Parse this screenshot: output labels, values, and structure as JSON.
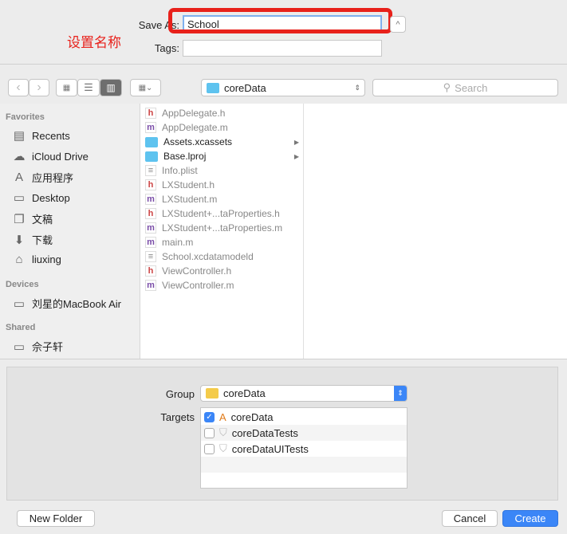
{
  "save_as": {
    "label": "Save As:",
    "value": "School",
    "tags_label": "Tags:",
    "tags_value": ""
  },
  "annotation": {
    "text": "设置名称",
    "color": "#e8211b"
  },
  "toolbar": {
    "location": "coreData",
    "search_placeholder": "Search"
  },
  "sidebar": {
    "sections": [
      {
        "title": "Favorites",
        "items": [
          {
            "label": "Recents",
            "icon": "recents-icon"
          },
          {
            "label": "iCloud Drive",
            "icon": "cloud-icon"
          },
          {
            "label": "应用程序",
            "icon": "applications-icon"
          },
          {
            "label": "Desktop",
            "icon": "desktop-icon"
          },
          {
            "label": "文稿",
            "icon": "documents-icon"
          },
          {
            "label": "下载",
            "icon": "download-icon"
          },
          {
            "label": "liuxing",
            "icon": "home-icon"
          }
        ]
      },
      {
        "title": "Devices",
        "items": [
          {
            "label": "刘星的MacBook Air",
            "icon": "laptop-icon"
          }
        ]
      },
      {
        "title": "Shared",
        "items": [
          {
            "label": "佘子轩",
            "icon": "laptop-icon"
          }
        ]
      }
    ]
  },
  "files": [
    {
      "name": "AppDelegate.h",
      "type": "h"
    },
    {
      "name": "AppDelegate.m",
      "type": "m"
    },
    {
      "name": "Assets.xcassets",
      "type": "folder"
    },
    {
      "name": "Base.lproj",
      "type": "folder"
    },
    {
      "name": "Info.plist",
      "type": "plist"
    },
    {
      "name": "LXStudent.h",
      "type": "h"
    },
    {
      "name": "LXStudent.m",
      "type": "m"
    },
    {
      "name": "LXStudent+...taProperties.h",
      "type": "h"
    },
    {
      "name": "LXStudent+...taProperties.m",
      "type": "m"
    },
    {
      "name": "main.m",
      "type": "m"
    },
    {
      "name": "School.xcdatamodeld",
      "type": "model"
    },
    {
      "name": "ViewController.h",
      "type": "h"
    },
    {
      "name": "ViewController.m",
      "type": "m"
    }
  ],
  "options": {
    "group_label": "Group",
    "group_value": "coreData",
    "targets_label": "Targets",
    "targets": [
      {
        "name": "coreData",
        "checked": true
      },
      {
        "name": "coreDataTests",
        "checked": false
      },
      {
        "name": "coreDataUITests",
        "checked": false
      }
    ]
  },
  "buttons": {
    "new_folder": "New Folder",
    "cancel": "Cancel",
    "create": "Create"
  },
  "colors": {
    "accent": "#3b86f7",
    "highlight": "#e8211b"
  }
}
